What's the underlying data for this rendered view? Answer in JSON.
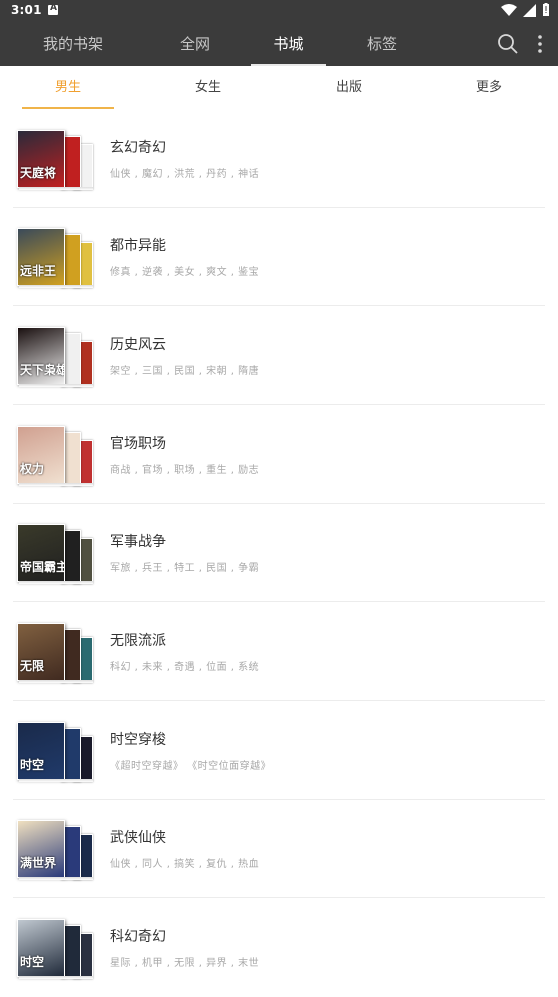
{
  "status_bar": {
    "time": "3:01"
  },
  "header": {
    "tabs": [
      {
        "label": "我的书架"
      },
      {
        "label": "全网"
      },
      {
        "label": "书城"
      },
      {
        "label": "标签"
      }
    ],
    "active_tab": 2
  },
  "subtabs": {
    "items": [
      {
        "label": "男生"
      },
      {
        "label": "女生"
      },
      {
        "label": "出版"
      },
      {
        "label": "更多"
      }
    ],
    "active": 0,
    "accent_color": "#f0a030"
  },
  "categories": [
    {
      "title": "玄幻奇幻",
      "tags": "仙侠 , 魔幻 , 洪荒 , 丹药 , 神话",
      "cover_text": "天庭将",
      "colors": [
        "#2a2a3a",
        "#c02020",
        "#f2f2f2"
      ]
    },
    {
      "title": "都市异能",
      "tags": "修真 , 逆袭 , 美女 , 爽文 , 鉴宝",
      "cover_text": "远非王",
      "colors": [
        "#3a4a5a",
        "#d0a020",
        "#e0c040"
      ]
    },
    {
      "title": "历史风云",
      "tags": "架空 , 三国 , 民国 , 宋朝 , 隋唐",
      "cover_text": "天下枭雄",
      "colors": [
        "#1a1010",
        "#f0f0f0",
        "#b03020"
      ]
    },
    {
      "title": "官场职场",
      "tags": "商战 , 官场 , 职场 , 重生 , 励志",
      "cover_text": "权力",
      "colors": [
        "#d0a090",
        "#f0e0d0",
        "#c03030"
      ]
    },
    {
      "title": "军事战争",
      "tags": "军旅 , 兵王 , 特工 , 民国 , 争霸",
      "cover_text": "帝国霸主",
      "colors": [
        "#3a3a2a",
        "#202020",
        "#505040"
      ]
    },
    {
      "title": "无限流派",
      "tags": "科幻 , 未来 , 奇遇 , 位面 , 系统",
      "cover_text": "无限",
      "colors": [
        "#806040",
        "#402a20",
        "#2a6a70"
      ]
    },
    {
      "title": "时空穿梭",
      "tags": "《超时空穿越》 《时空位面穿越》",
      "cover_text": "时空",
      "colors": [
        "#1a2a4a",
        "#203a6a",
        "#1a1a2a"
      ]
    },
    {
      "title": "武侠仙侠",
      "tags": "仙侠 , 同人 , 搞笑 , 复仇 , 热血",
      "cover_text": "满世界",
      "colors": [
        "#f0e0c0",
        "#2a3a7a",
        "#1a2a4a"
      ]
    },
    {
      "title": "科幻奇幻",
      "tags": "星际 , 机甲 , 无限 , 异界 , 末世",
      "cover_text": "时空",
      "colors": [
        "#c0c8d0",
        "#202a3a",
        "#2a3040"
      ]
    }
  ]
}
